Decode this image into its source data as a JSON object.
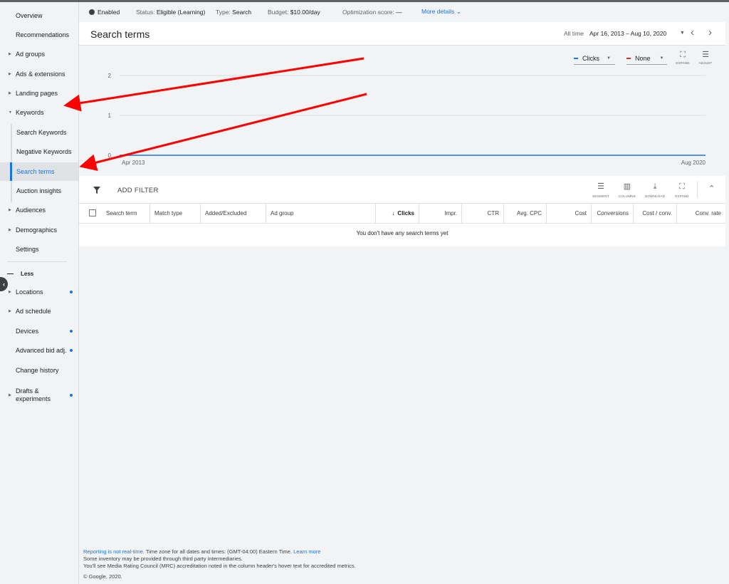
{
  "sidebar": {
    "items": [
      {
        "label": "Overview"
      },
      {
        "label": "Recommendations"
      },
      {
        "label": "Ad groups"
      },
      {
        "label": "Ads & extensions"
      },
      {
        "label": "Landing pages"
      },
      {
        "label": "Keywords"
      },
      {
        "label": "Search Keywords"
      },
      {
        "label": "Negative Keywords"
      },
      {
        "label": "Search terms"
      },
      {
        "label": "Auction insights"
      },
      {
        "label": "Audiences"
      },
      {
        "label": "Demographics"
      },
      {
        "label": "Settings"
      },
      {
        "label": "Locations"
      },
      {
        "label": "Ad schedule"
      },
      {
        "label": "Devices"
      },
      {
        "label": "Advanced bid adj."
      },
      {
        "label": "Change history"
      },
      {
        "label": "Drafts & experiments"
      }
    ],
    "less_label": "Less",
    "active_item": "Search terms"
  },
  "status_bar": {
    "status": "Enabled",
    "status_label": "Status:",
    "status_value": "Eligible (Learning)",
    "type_label": "Type:",
    "type_value": "Search",
    "budget_label": "Budget:",
    "budget_value": "$10.00/day",
    "optimization_label": "Optimization score:",
    "optimization_value": "—",
    "more_details": "More details"
  },
  "header": {
    "title": "Search terms",
    "date_label": "All time",
    "date_range": "Apr 16, 2013 – Aug 10, 2020"
  },
  "chart": {
    "metric1": "Clicks",
    "metric2": "None",
    "expand_label": "EXPAND",
    "adjust_label": "ADJUST",
    "metric1_color": "#1a73e8",
    "metric2_color": "#d93025"
  },
  "chart_data": {
    "type": "line",
    "x": [
      "Apr 2013",
      "Aug 2020"
    ],
    "series": [
      {
        "name": "Clicks",
        "values": [
          0,
          0
        ]
      }
    ],
    "yticks": [
      "0",
      "1",
      "2"
    ],
    "ylim": [
      0,
      2
    ],
    "grid": true
  },
  "table": {
    "add_filter": "ADD FILTER",
    "tools": {
      "segment": "SEGMENT",
      "columns": "COLUMNS",
      "download": "DOWNLOAD",
      "expand": "EXPAND"
    },
    "columns": [
      "Search term",
      "Match type",
      "Added/Excluded",
      "Ad group",
      "Clicks",
      "Impr.",
      "CTR",
      "Avg. CPC",
      "Cost",
      "Conversions",
      "Cost / conv.",
      "Conv. rate"
    ],
    "sort_indicator": "↓",
    "empty_message": "You don't have any search terms yet"
  },
  "footer": {
    "realtime_link": "Reporting is not real-time.",
    "timezone_text": "Time zone for all dates and times: (GMT-04:00) Eastern Time.",
    "learn_more": "Learn more",
    "line2": "Some inventory may be provided through third party intermediaries.",
    "line3": "You'll see Media Rating Council (MRC) accreditation noted in the column header's hover text for accredited metrics.",
    "copyright": "© Google, 2020."
  },
  "colors": {
    "accent": "#1a73e8",
    "annotation": "#ff0000"
  }
}
